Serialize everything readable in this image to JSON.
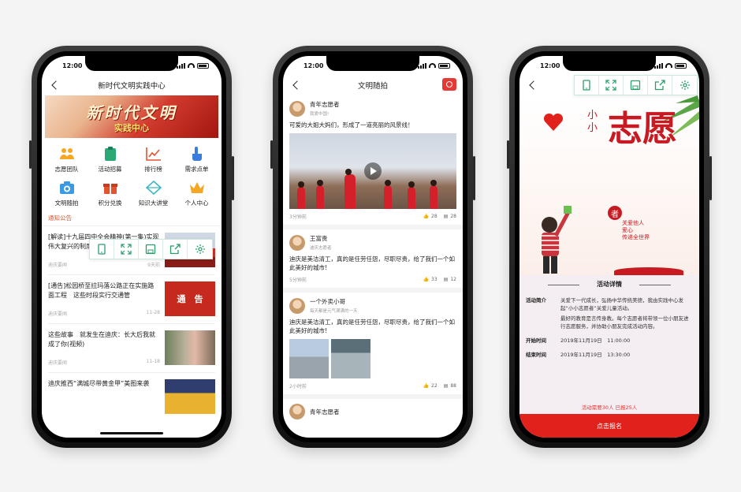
{
  "status_time": "12:00",
  "colors": {
    "accent_red": "#e1221c",
    "toolbar_green": "#2a9d6a",
    "notice_orange": "#e2542f"
  },
  "toolbar_icons": [
    "tablet-icon",
    "expand-icon",
    "save-icon",
    "share-icon",
    "gear-icon"
  ],
  "phone1": {
    "title": "新时代文明实践中心",
    "banner": {
      "line1": "新时代文明",
      "line2": "实践中心"
    },
    "grid": [
      {
        "label": "志愿团队",
        "icon": "team-icon"
      },
      {
        "label": "活动招募",
        "icon": "clipboard-icon"
      },
      {
        "label": "排行榜",
        "icon": "chart-icon"
      },
      {
        "label": "需求点单",
        "icon": "hand-icon"
      },
      {
        "label": "文明随拍",
        "icon": "camera-icon"
      },
      {
        "label": "积分兑换",
        "icon": "gift-icon"
      },
      {
        "label": "知识大讲堂",
        "icon": "diamond-icon"
      },
      {
        "label": "个人中心",
        "icon": "crown-icon"
      }
    ],
    "notice": "通知公告",
    "news": [
      {
        "title": "[解读]十九届四中全会精神(第一集)实现伟大复兴的制度保障",
        "source": "迪庆要闻",
        "time": "9天前"
      },
      {
        "title": "[通告]松园桥至拉玛落公路正在实施路面工程　这些时段实行交通管",
        "source": "迪庆要闻",
        "time": "11-28"
      },
      {
        "title": "这些故事　就发生在迪庆：长大后我就成了你(视频)",
        "source": "迪庆要闻",
        "time": "11-18"
      },
      {
        "title": "迪庆推西“满城尽带黄金甲”美图来袭",
        "source": "",
        "time": ""
      }
    ],
    "news_thumb_text": "通　告"
  },
  "phone2": {
    "title": "文明随拍",
    "posts": [
      {
        "name": "青年志愿者",
        "sub": "我爱中国!",
        "text": "可爱的大姐大妈们，形成了一道亮丽的风景线！",
        "time": "3分钟前",
        "likes": "28",
        "comments": "28"
      },
      {
        "name": "王富贵",
        "sub": "迪庆志愿者",
        "text": "迪庆是美洁清工，真的是任劳任怨，尽职尽责，给了我们一个如此美好的城市!",
        "time": "5分钟前",
        "likes": "33",
        "comments": "12"
      },
      {
        "name": "一个外卖小哥",
        "sub": "每天都是元气满满的一天",
        "text": "迪庆是美洁清工，真的是任劳任怨，尽职尽责，给了我们一个如此美好的城市!",
        "time": "2小时前",
        "likes": "22",
        "comments": "88"
      },
      {
        "name": "青年志愿者",
        "sub": "",
        "text": "",
        "time": "",
        "likes": "",
        "comments": ""
      }
    ]
  },
  "phone3": {
    "poster": {
      "small": "小小",
      "big": "志愿",
      "badge": "者",
      "slogan": [
        "关爱他人",
        "爱心",
        "传递全世界"
      ]
    },
    "detail_title": "活动详情",
    "intro_label": "活动简介",
    "intro_p1": "关爱下一代成长，弘扬中华传统美德，我由实践中心发起“小小志愿者”关爱儿童活动。",
    "intro_p2": "最好的教育是言传身教。每个志愿者将带领一位小朋友进行志愿服务，并协助小朋友完成活动内容。",
    "start_label": "开始时间",
    "start_value": "2019年11月19日　11:00:00",
    "end_label": "结束时间",
    "end_value": "2019年11月19日　13:30:00",
    "quota": "活动需要30人 已报25人",
    "signup": "点击报名"
  }
}
